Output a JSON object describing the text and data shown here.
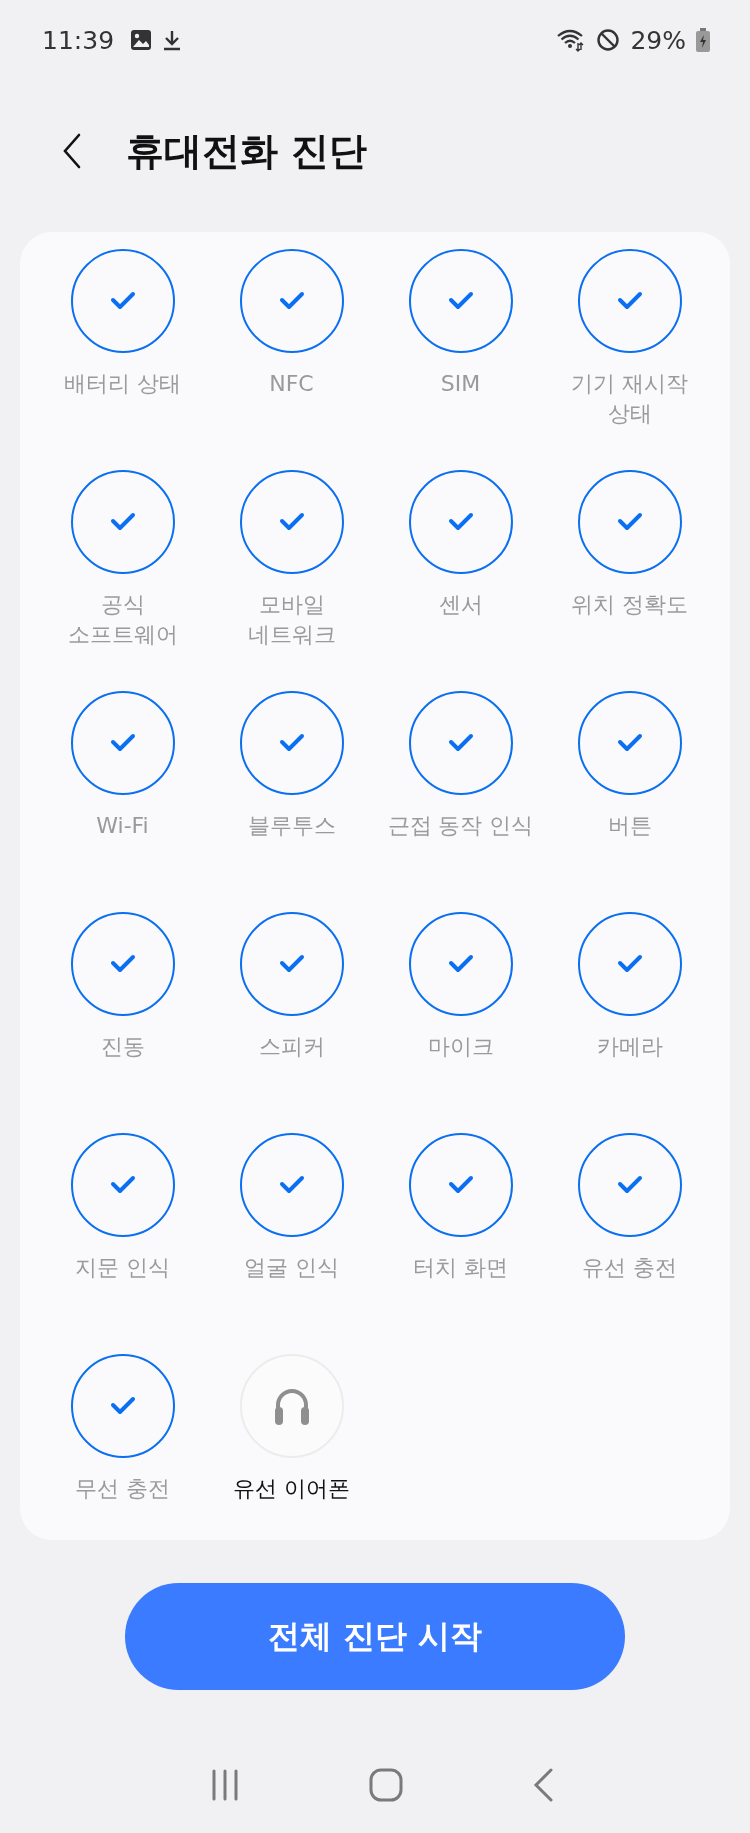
{
  "status_bar": {
    "time": "11:39",
    "battery": "29%"
  },
  "header": {
    "title": "휴대전화 진단"
  },
  "tests": [
    {
      "label": "배터리 상태",
      "checked": true
    },
    {
      "label": "NFC",
      "checked": true
    },
    {
      "label": "SIM",
      "checked": true
    },
    {
      "label": "기기 재시작 상태",
      "checked": true
    },
    {
      "label": "공식 소프트웨어",
      "checked": true
    },
    {
      "label": "모바일 네트워크",
      "checked": true
    },
    {
      "label": "센서",
      "checked": true
    },
    {
      "label": "위치 정확도",
      "checked": true
    },
    {
      "label": "Wi-Fi",
      "checked": true
    },
    {
      "label": "블루투스",
      "checked": true
    },
    {
      "label": "근접 동작 인식",
      "checked": true
    },
    {
      "label": "버튼",
      "checked": true
    },
    {
      "label": "진동",
      "checked": true
    },
    {
      "label": "스피커",
      "checked": true
    },
    {
      "label": "마이크",
      "checked": true
    },
    {
      "label": "카메라",
      "checked": true
    },
    {
      "label": "지문 인식",
      "checked": true
    },
    {
      "label": "얼굴 인식",
      "checked": true
    },
    {
      "label": "터치 화면",
      "checked": true
    },
    {
      "label": "유선 충전",
      "checked": true
    },
    {
      "label": "무선 충전",
      "checked": true
    },
    {
      "label": "유선 이어폰",
      "checked": false
    }
  ],
  "start_button": "전체 진단 시작"
}
